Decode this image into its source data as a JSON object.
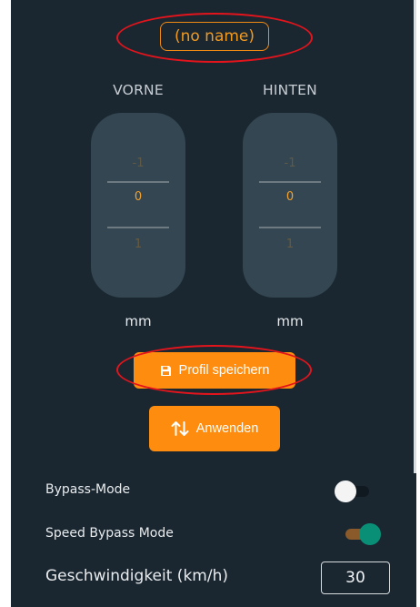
{
  "profile": {
    "name": "(no name)"
  },
  "front": {
    "label": "VORNE",
    "values": [
      "-1",
      "0",
      "1"
    ],
    "unit": "mm"
  },
  "back": {
    "label": "HINTEN",
    "values": [
      "-1",
      "0",
      "1"
    ],
    "unit": "mm"
  },
  "buttons": {
    "save_label": "Profil speichern",
    "save_icon": "floppy-disk-icon",
    "apply_label": "Anwenden",
    "apply_icon": "swap-vertical-arrows-icon"
  },
  "settings": {
    "bypass_label": "Bypass-Mode",
    "bypass_on": false,
    "speed_bypass_label": "Speed Bypass Mode",
    "speed_bypass_on": true,
    "speed_label": "Geschwindigkeit (km/h)",
    "speed_value": "30"
  },
  "colors": {
    "background": "#1a2731",
    "accent": "#fe8c0f",
    "picker": "#344651",
    "toggle_on": "#0a8f77",
    "annotation": "#e3141c"
  }
}
